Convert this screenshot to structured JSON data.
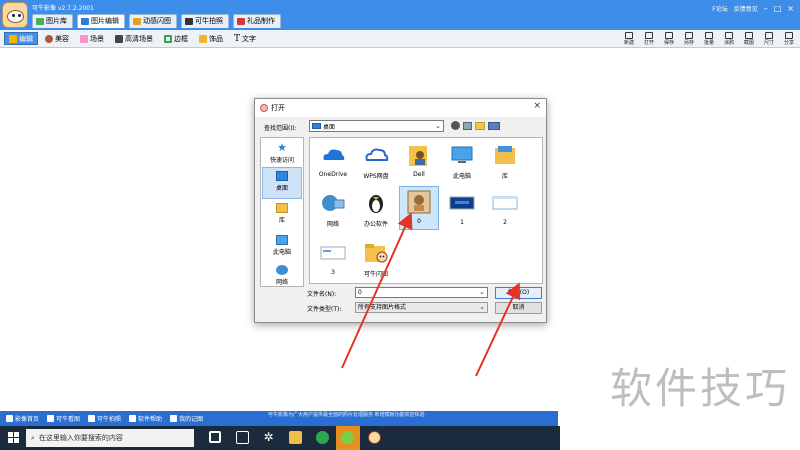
{
  "app": {
    "title": "可牛影像 v2.7.2.2001",
    "tabs": [
      "图片库",
      "图片编辑",
      "动感闪图",
      "可牛拍照",
      "礼品制作"
    ],
    "header_right": [
      "F论坛",
      "反馈意见"
    ]
  },
  "toolbar": {
    "left_items": [
      "编辑",
      "美容",
      "场景",
      "高清场景",
      "边框",
      "饰品",
      "文字"
    ],
    "right_buttons": [
      "新建",
      "打开",
      "保存",
      "另存",
      "批量",
      "涂鸦",
      "截图",
      "尺寸",
      "分享"
    ]
  },
  "dialog": {
    "title": "打开",
    "lookin_label": "查找范围(I):",
    "lookin_value": "桌面",
    "places": [
      "快速访问",
      "桌面",
      "库",
      "此电脑",
      "网络"
    ],
    "files": [
      {
        "name": "OneDrive",
        "icon": "onedrive-icon"
      },
      {
        "name": "WPS网盘",
        "icon": "wps-cloud-icon"
      },
      {
        "name": "Dell",
        "icon": "user-folder-icon"
      },
      {
        "name": "此电脑",
        "icon": "computer-icon"
      },
      {
        "name": "库",
        "icon": "library-icon"
      },
      {
        "name": "网络",
        "icon": "network-icon"
      },
      {
        "name": "办公软件",
        "icon": "penguin-icon"
      },
      {
        "name": "0",
        "icon": "image-thumbnail-icon"
      },
      {
        "name": "1",
        "icon": "image-thumbnail-icon"
      },
      {
        "name": "2",
        "icon": "image-thumbnail-icon"
      },
      {
        "name": "3",
        "icon": "image-thumbnail-icon"
      },
      {
        "name": "可牛闪图",
        "icon": "folder-icon"
      }
    ],
    "filename_label": "文件名(N):",
    "filename_value": "0",
    "filetype_label": "文件类型(T):",
    "filetype_value": "所有支持图片格式",
    "open_label": "打开(O)",
    "cancel_label": "取消"
  },
  "watermark": "软件技巧",
  "bottom_bar": {
    "items": [
      "影像首页",
      "可牛看图",
      "可牛拍照",
      "软件帮助",
      "我的记图"
    ],
    "scroll_text": "可牛影像为广大用户提供最全面的照片处理服务 新增模板功能欢迎体验"
  },
  "taskbar": {
    "search_placeholder": "在这里输入你要搜索的内容"
  },
  "colors": {
    "app_blue": "#3d8ee8",
    "arrow_red": "#e53327",
    "taskbar": "#1b2a3c",
    "selection": "#cde6fb"
  }
}
